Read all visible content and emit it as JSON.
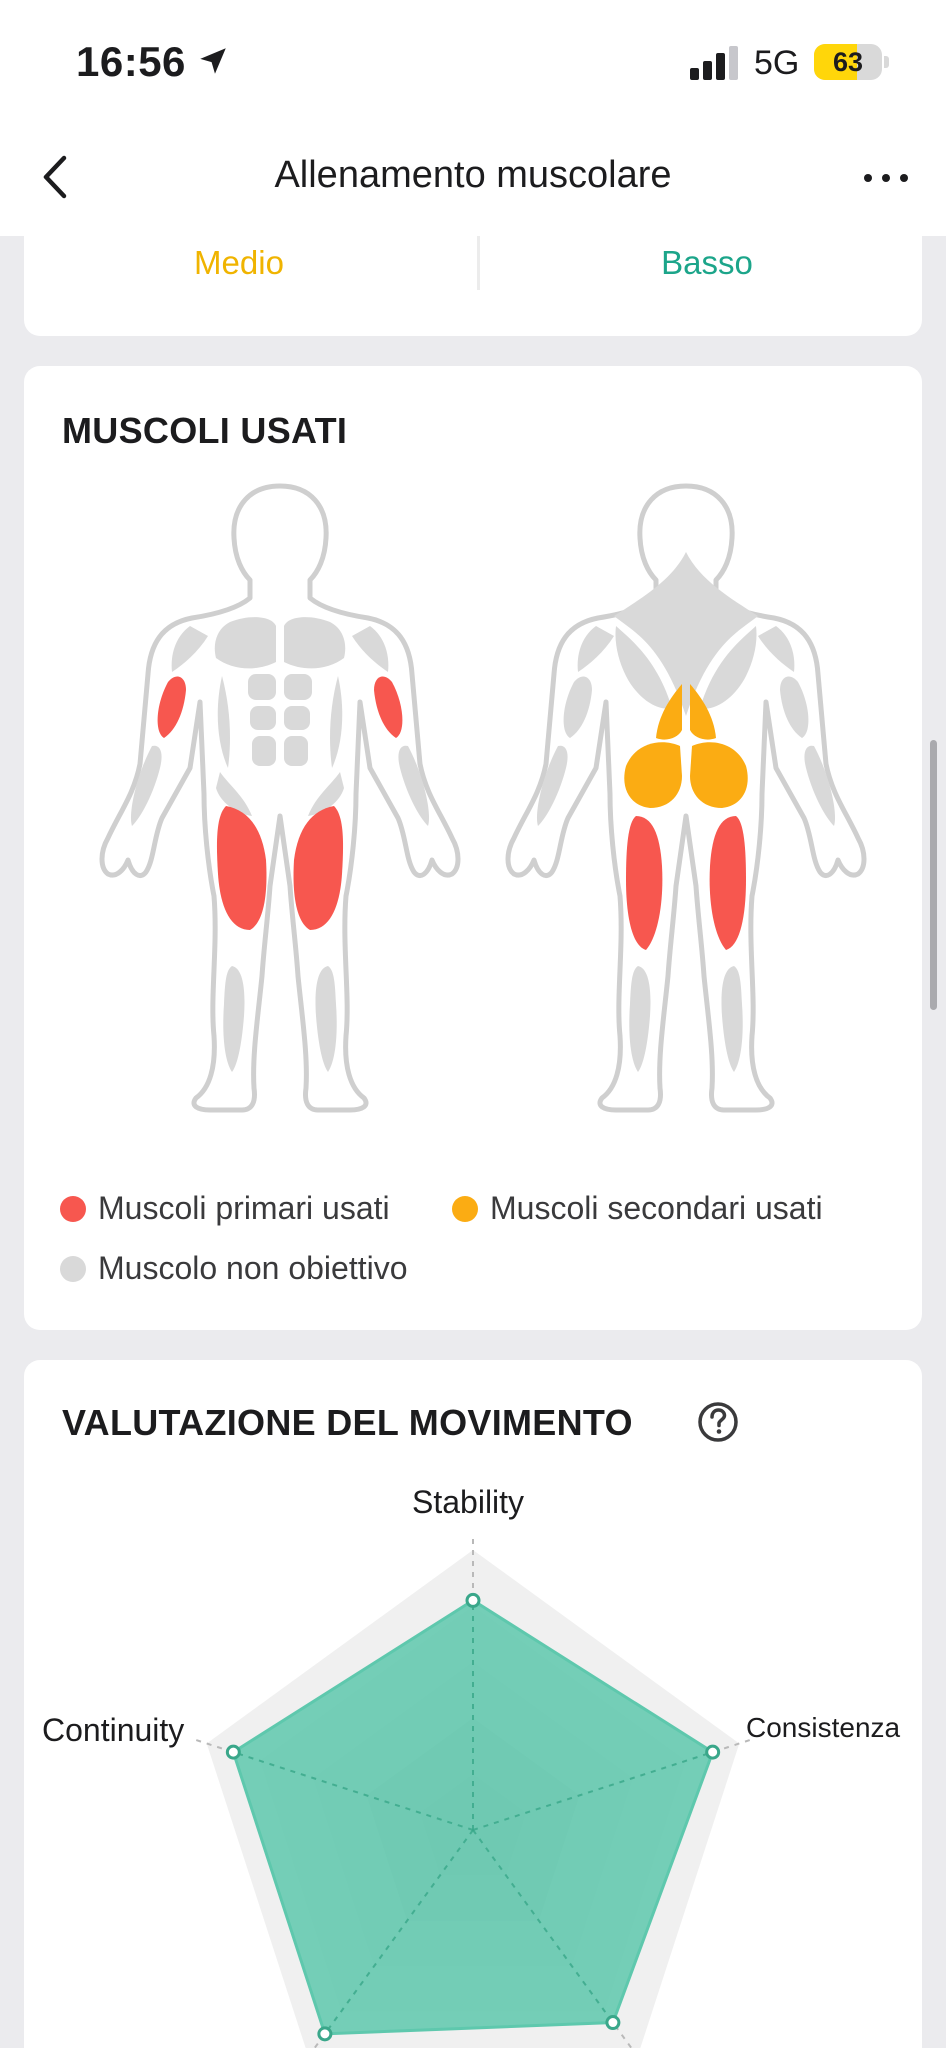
{
  "status_bar": {
    "time": "16:56",
    "network": "5G",
    "battery": "63",
    "battery_level": 0.63
  },
  "nav": {
    "title": "Allenamento muscolare"
  },
  "intensity": {
    "left": "Medio",
    "right": "Basso"
  },
  "muscles": {
    "title": "MUSCOLI USATI",
    "legend": {
      "primary": "Muscoli primari usati",
      "secondary": "Muscoli secondari usati",
      "non_target": "Muscolo non obiettivo"
    },
    "colors": {
      "primary": "#f7574f",
      "secondary": "#fbac13",
      "non_target": "#d9d9d9",
      "outline": "#c9c9c9"
    }
  },
  "evaluation": {
    "title": "VALUTAZIONE DEL MOVIMENTO",
    "axes": [
      "Stability",
      "Consistenza",
      "",
      "",
      "Continuity"
    ],
    "values": [
      0.82,
      0.9,
      0.85,
      0.9,
      0.9
    ],
    "colors": {
      "fill": "#5ec8ad",
      "grid": "#efefef"
    }
  }
}
